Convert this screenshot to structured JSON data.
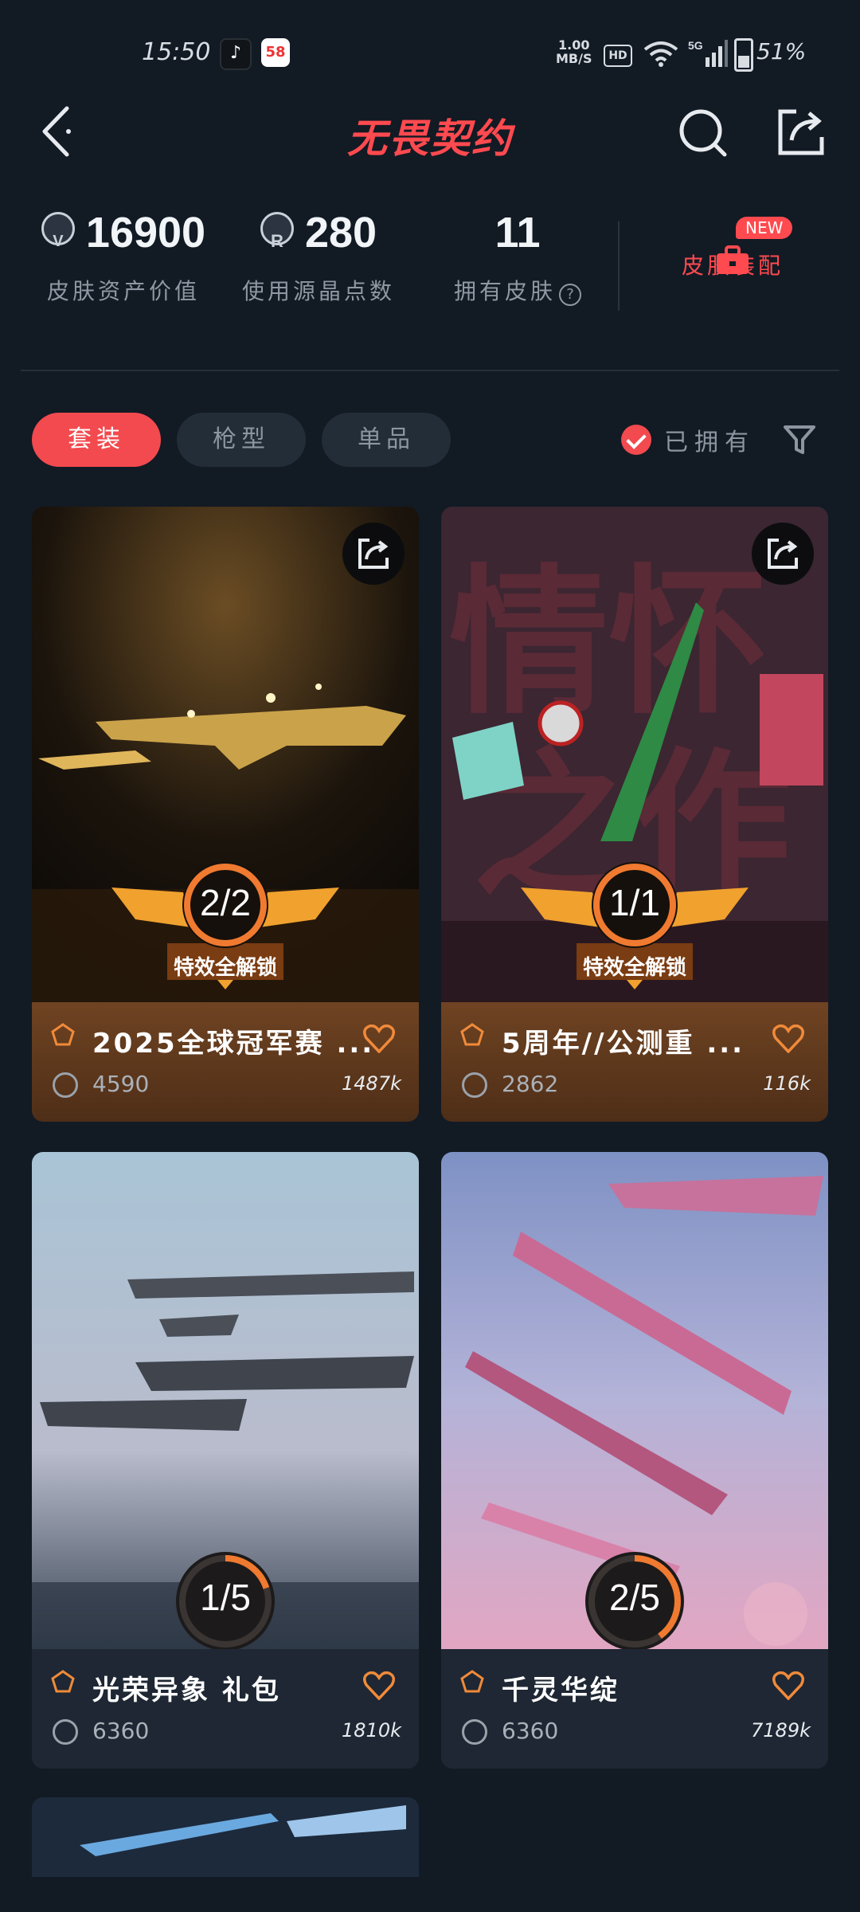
{
  "status": {
    "time": "15:50",
    "speed_top": "1.00",
    "speed_unit": "MB/S",
    "hd": "HD",
    "network": "5G",
    "battery": "51%"
  },
  "header": {
    "title": "无畏契约"
  },
  "stats": [
    {
      "value": "16900",
      "label": "皮肤资产价值",
      "icon": "vp-coin-icon"
    },
    {
      "value": "280",
      "label": "使用源晶点数",
      "icon": "radianite-icon"
    },
    {
      "value": "11",
      "label": "拥有皮肤",
      "icon": "help-icon"
    }
  ],
  "match": {
    "label": "皮肤装配",
    "badge": "NEW"
  },
  "tabs": [
    "套装",
    "枪型",
    "单品"
  ],
  "filter": {
    "owned_label": "已拥有"
  },
  "cards": [
    {
      "name": "2025全球冠军赛 ...",
      "price": "4590",
      "likes": "1487k",
      "progress": "2/2",
      "unlock": "特效全解锁",
      "progress_fraction": 1.0
    },
    {
      "name": "5周年//公测重 ...",
      "price": "2862",
      "likes": "116k",
      "progress": "1/1",
      "unlock": "特效全解锁",
      "progress_fraction": 1.0
    },
    {
      "name": "光荣异象 礼包",
      "price": "6360",
      "likes": "1810k",
      "progress": "1/5",
      "progress_fraction": 0.2
    },
    {
      "name": "千灵华绽",
      "price": "6360",
      "likes": "7189k",
      "progress": "2/5",
      "progress_fraction": 0.4
    }
  ],
  "colors": {
    "accent": "#ff4a4f",
    "bg": "#121a24",
    "tab_bg": "#232d38"
  }
}
